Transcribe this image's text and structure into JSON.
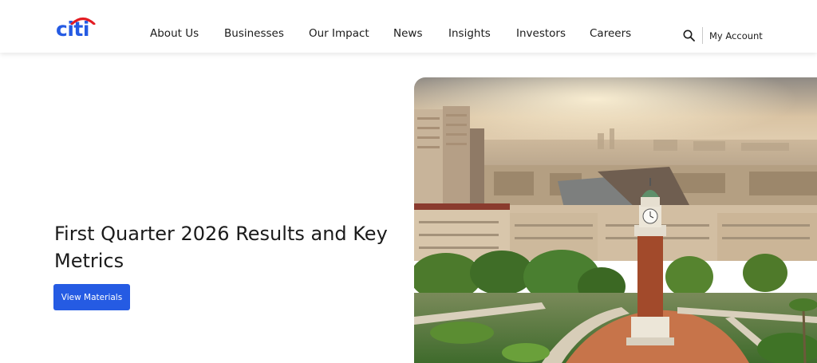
{
  "brand": {
    "logo_text": "citi",
    "brand_color": "#255be3",
    "arc_color": "#e31c23"
  },
  "nav": {
    "items": [
      {
        "label": "About Us"
      },
      {
        "label": "Businesses"
      },
      {
        "label": "Our Impact"
      },
      {
        "label": "News"
      },
      {
        "label": "Insights"
      },
      {
        "label": "Investors"
      },
      {
        "label": "Careers"
      }
    ],
    "search_icon": "search-icon",
    "account_label": "My Account"
  },
  "hero": {
    "title": "First Quarter 2026 Results and Key Metrics",
    "cta_label": "View Materials",
    "image_subject": "aerial city view with clock tower"
  }
}
